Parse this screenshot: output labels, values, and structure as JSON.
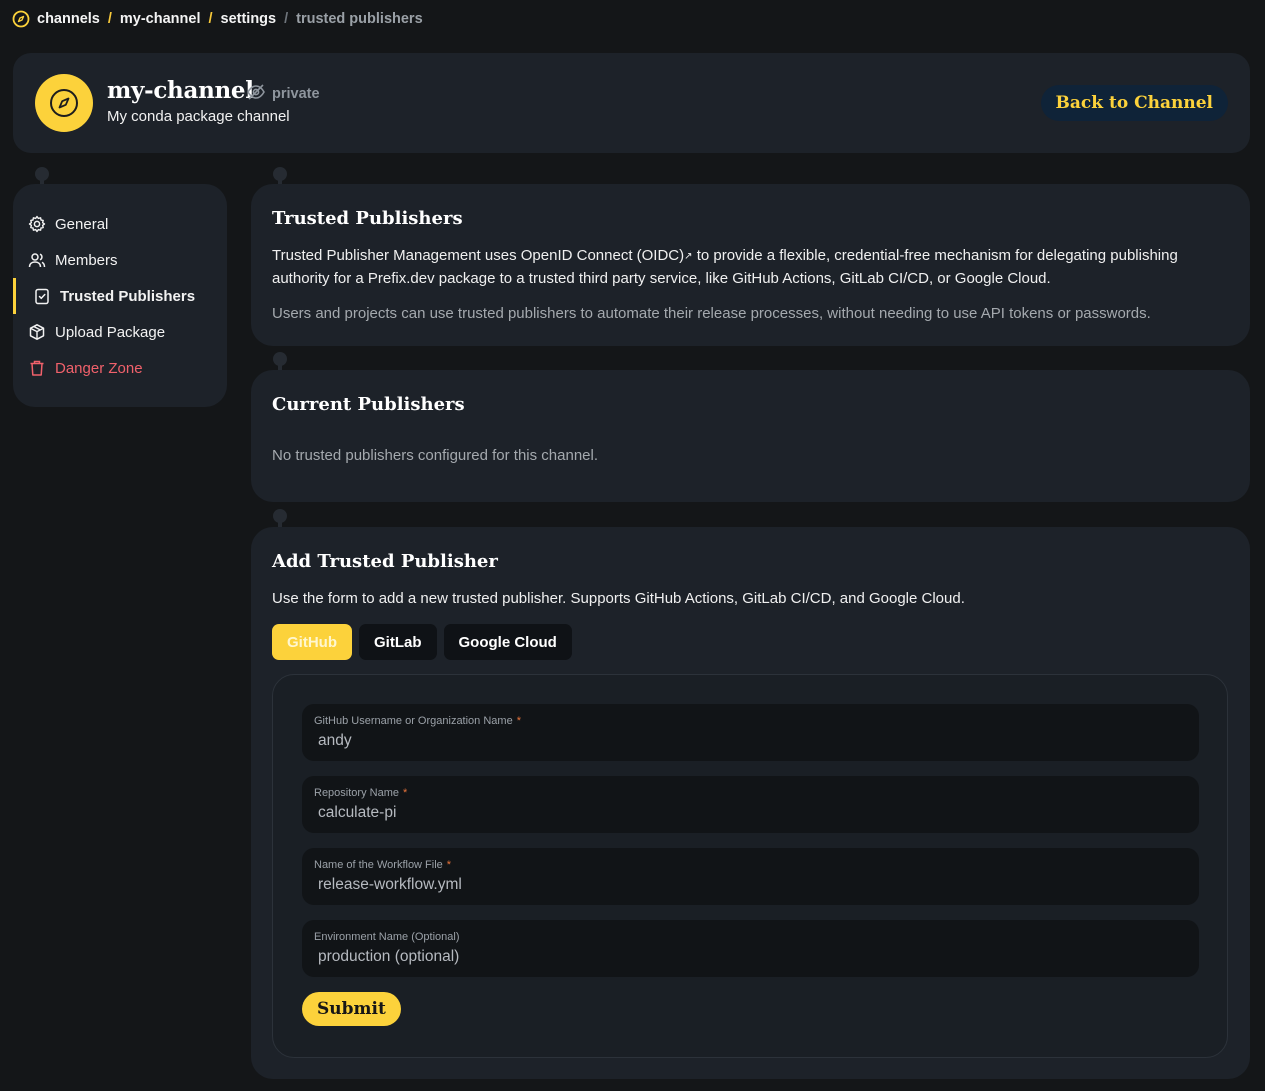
{
  "breadcrumb": {
    "items": [
      "channels",
      "my-channel",
      "settings"
    ],
    "current": "trusted publishers",
    "separator": "/"
  },
  "header": {
    "title": "my-channel",
    "visibility": "private",
    "description": "My conda package channel",
    "back_button": "Back to Channel"
  },
  "sidebar": {
    "items": [
      {
        "label": "General",
        "icon": "gear-icon"
      },
      {
        "label": "Members",
        "icon": "users-icon"
      },
      {
        "label": "Trusted Publishers",
        "icon": "clipboard-check-icon",
        "active": true
      },
      {
        "label": "Upload Package",
        "icon": "package-icon"
      },
      {
        "label": "Danger Zone",
        "icon": "trash-icon",
        "danger": true
      }
    ]
  },
  "trusted": {
    "title": "Trusted Publishers",
    "p1_before": "Trusted Publisher Management uses ",
    "p1_link": "OpenID Connect (OIDC)",
    "p1_after": " to provide a flexible, credential-free mechanism for delegating publishing authority for a Prefix.dev package to a trusted third party service, like GitHub Actions, GitLab CI/CD, or Google Cloud.",
    "p2": "Users and projects can use trusted publishers to automate their release processes, without needing to use API tokens or passwords."
  },
  "current": {
    "title": "Current Publishers",
    "empty": "No trusted publishers configured for this channel."
  },
  "add": {
    "title": "Add Trusted Publisher",
    "description": "Use the form to add a new trusted publisher. Supports GitHub Actions, GitLab CI/CD, and Google Cloud.",
    "tabs": [
      "GitHub",
      "GitLab",
      "Google Cloud"
    ],
    "active_tab": "GitHub",
    "fields": [
      {
        "label": "GitHub Username or Organization Name",
        "required": "*",
        "placeholder": "andy"
      },
      {
        "label": "Repository Name",
        "required": "*",
        "placeholder": "calculate-pi"
      },
      {
        "label": "Name of the Workflow File",
        "required": "*",
        "placeholder": "release-workflow.yml"
      },
      {
        "label": "Environment Name (Optional)",
        "required": "",
        "placeholder": "production (optional)"
      }
    ],
    "submit": "Submit"
  },
  "colors": {
    "accent": "#fcd23b",
    "background": "#141618",
    "card": "#1d2229",
    "danger": "#f0616b"
  }
}
